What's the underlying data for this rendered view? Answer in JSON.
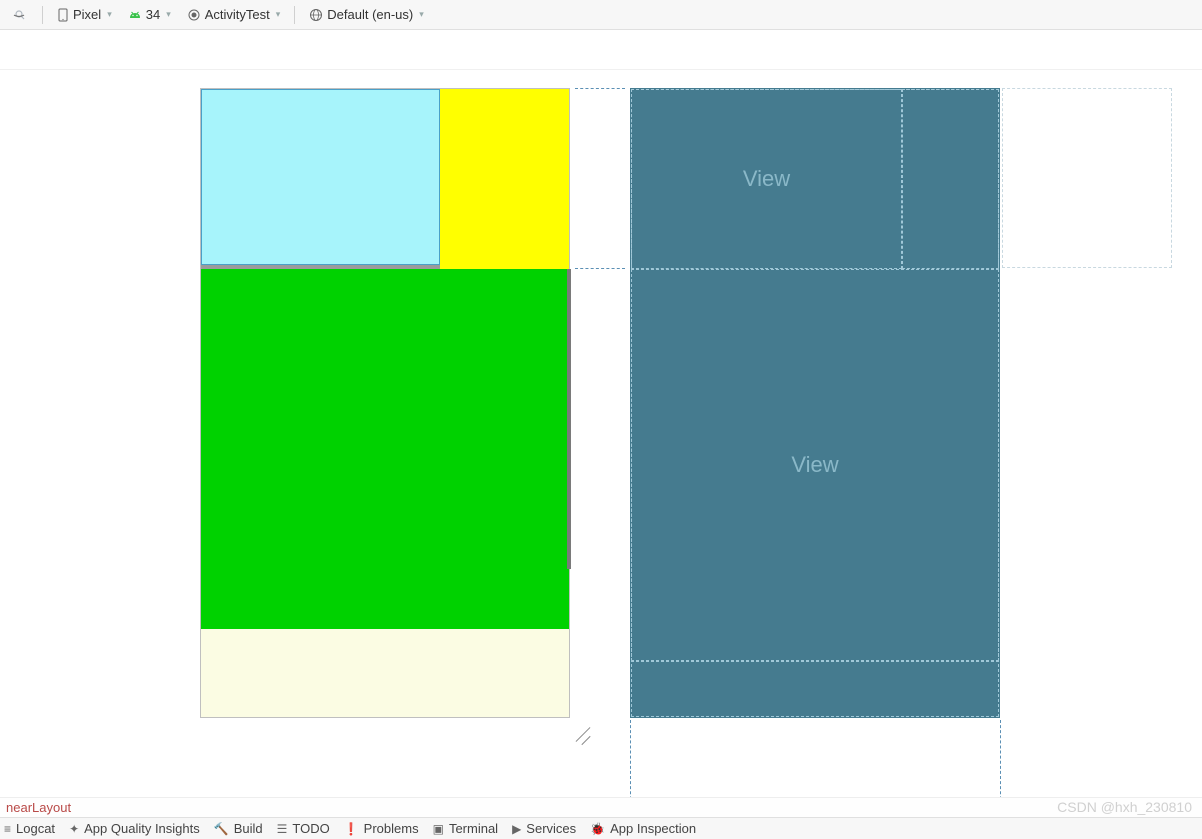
{
  "toolbar": {
    "device": "Pixel",
    "api": "34",
    "activity": "ActivityTest",
    "locale": "Default (en-us)"
  },
  "blueprint": {
    "label_top": "View",
    "label_mid": "View"
  },
  "breadcrumb": {
    "path_tail": "nearLayout"
  },
  "bottom": {
    "logcat": "Logcat",
    "insights": "App Quality Insights",
    "build": "Build",
    "todo": "TODO",
    "problems": "Problems",
    "terminal": "Terminal",
    "services": "Services",
    "inspection": "App Inspection"
  },
  "watermark": "CSDN @hxh_230810"
}
